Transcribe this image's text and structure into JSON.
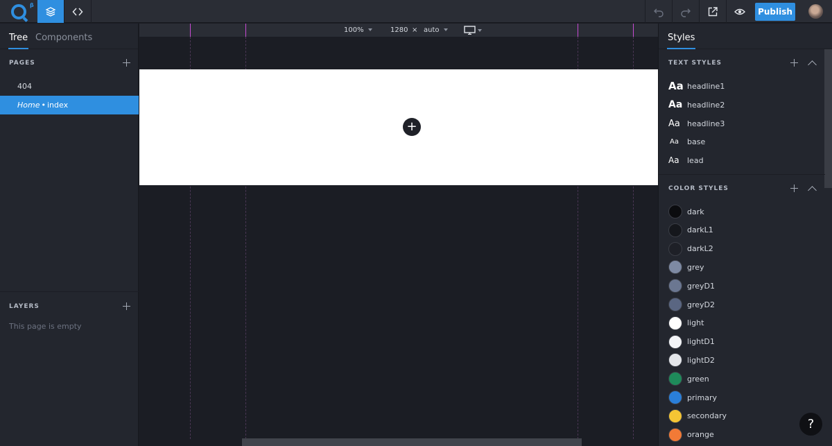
{
  "app": {
    "logo_badge": "β",
    "accent": "#2f8fe0"
  },
  "toolbar": {
    "layers_icon": "layers-icon",
    "code_icon": "code-icon",
    "undo_icon": "undo-icon",
    "redo_icon": "redo-icon",
    "open_icon": "external-link-icon",
    "preview_icon": "eye-icon",
    "publish_label": "Publish"
  },
  "left": {
    "tabs": [
      {
        "label": "Tree"
      },
      {
        "label": "Components"
      }
    ],
    "pages_title": "PAGES",
    "pages": [
      {
        "label": "404"
      },
      {
        "home": "Home",
        "separator": "•",
        "label": "index"
      }
    ],
    "layers_title": "LAYERS",
    "layers_empty": "This page is empty"
  },
  "canvas": {
    "zoom": "100%",
    "width": "1280",
    "times": "×",
    "height": "auto",
    "device_icon": "monitor-icon",
    "add_symbol": "+"
  },
  "right": {
    "tab": "Styles",
    "text_styles_title": "TEXT STYLES",
    "text_styles": [
      {
        "sample": "Aa",
        "name": "headline1"
      },
      {
        "sample": "Aa",
        "name": "headline2"
      },
      {
        "sample": "Aa",
        "name": "headline3"
      },
      {
        "sample": "Aa",
        "name": "base"
      },
      {
        "sample": "Aa",
        "name": "lead"
      }
    ],
    "color_styles_title": "COLOR STYLES",
    "color_styles": [
      {
        "name": "dark",
        "color": "#0b0c0f"
      },
      {
        "name": "darkL1",
        "color": "#15171c"
      },
      {
        "name": "darkL2",
        "color": "#1e2027"
      },
      {
        "name": "grey",
        "color": "#7e8aa3"
      },
      {
        "name": "greyD1",
        "color": "#6b7791"
      },
      {
        "name": "greyD2",
        "color": "#5a6682"
      },
      {
        "name": "light",
        "color": "#ffffff"
      },
      {
        "name": "lightD1",
        "color": "#f2f3f6"
      },
      {
        "name": "lightD2",
        "color": "#e4e6ea"
      },
      {
        "name": "green",
        "color": "#1e8a5a"
      },
      {
        "name": "primary",
        "color": "#2a7fd9"
      },
      {
        "name": "secondary",
        "color": "#f5c534"
      },
      {
        "name": "orange",
        "color": "#f27a36"
      }
    ]
  },
  "help": {
    "label": "?"
  }
}
